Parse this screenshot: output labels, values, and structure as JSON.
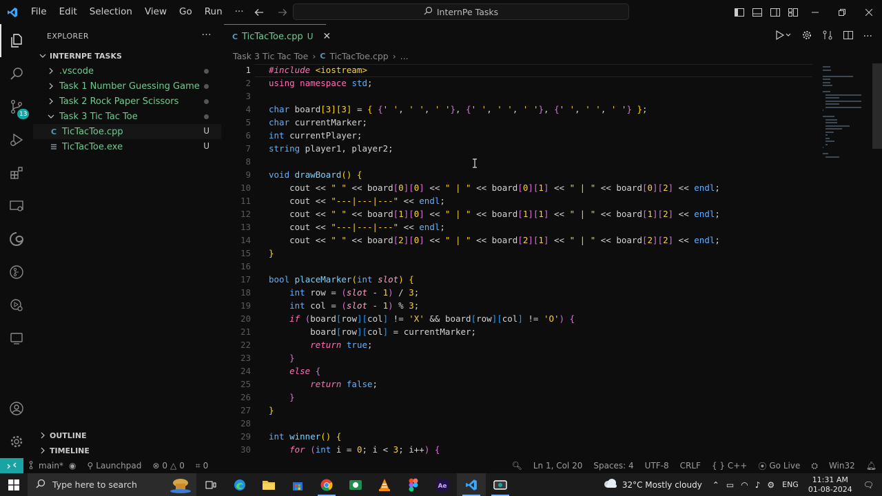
{
  "menu": [
    "File",
    "Edit",
    "Selection",
    "View",
    "Go",
    "Run",
    "···"
  ],
  "command_center": "InternPe Tasks",
  "activity": {
    "scm_badge": "13"
  },
  "sidebar": {
    "header": "EXPLORER",
    "workspace": "INTERNPE TASKS",
    "tree": [
      {
        "label": ".vscode",
        "depth": 1,
        "kind": "folder",
        "expanded": false,
        "color": "#73c991",
        "marker": "dot"
      },
      {
        "label": "Task 1 Number Guessing Game",
        "depth": 1,
        "kind": "folder",
        "expanded": false,
        "color": "#73c991",
        "marker": "dot"
      },
      {
        "label": "Task 2 Rock Paper Scissors",
        "depth": 1,
        "kind": "folder",
        "expanded": false,
        "color": "#73c991",
        "marker": "dot"
      },
      {
        "label": "Task 3 Tic Tac Toe",
        "depth": 1,
        "kind": "folder",
        "expanded": true,
        "color": "#73c991",
        "marker": "dot"
      },
      {
        "label": "TicTacToe.cpp",
        "depth": 2,
        "kind": "cpp",
        "color": "#73c991",
        "marker": "U"
      },
      {
        "label": "TicTacToe.exe",
        "depth": 2,
        "kind": "exe",
        "color": "#73c991",
        "marker": "U"
      }
    ],
    "outline": "OUTLINE",
    "timeline": "TIMELINE"
  },
  "tab": {
    "icon": "C",
    "name": "TicTacToe.cpp",
    "status": "U"
  },
  "breadcrumbs": {
    "folder": "Task 3 Tic Tac Toe",
    "icon": "C",
    "file": "TicTacToe.cpp",
    "more": "..."
  },
  "code_lines": [
    {
      "n": "1",
      "tokens": [
        [
          "k-pp",
          "#include"
        ],
        [
          "k-var",
          " "
        ],
        [
          "k-inc",
          "<iostream>"
        ]
      ]
    },
    {
      "n": "2",
      "tokens": [
        [
          "k-pink",
          "using"
        ],
        [
          "k-var",
          " "
        ],
        [
          "k-pink",
          "namespace"
        ],
        [
          "k-var",
          " "
        ],
        [
          "k-blue",
          "std"
        ],
        [
          "k-var",
          ";"
        ]
      ]
    },
    {
      "n": "3",
      "tokens": []
    },
    {
      "n": "4",
      "tokens": [
        [
          "k-blue",
          "char"
        ],
        [
          "k-var",
          " board"
        ],
        [
          "k-br1",
          "["
        ],
        [
          "k-num",
          "3"
        ],
        [
          "k-br1",
          "]["
        ],
        [
          "k-num",
          "3"
        ],
        [
          "k-br1",
          "]"
        ],
        [
          "k-var",
          " = "
        ],
        [
          "k-br1",
          "{ "
        ],
        [
          "k-br2",
          "{"
        ],
        [
          "k-str",
          "' '"
        ],
        [
          "k-var",
          ", "
        ],
        [
          "k-str",
          "' '"
        ],
        [
          "k-var",
          ", "
        ],
        [
          "k-str",
          "' '"
        ],
        [
          "k-br2",
          "}"
        ],
        [
          "k-var",
          ", "
        ],
        [
          "k-br2",
          "{"
        ],
        [
          "k-str",
          "' '"
        ],
        [
          "k-var",
          ", "
        ],
        [
          "k-str",
          "' '"
        ],
        [
          "k-var",
          ", "
        ],
        [
          "k-str",
          "' '"
        ],
        [
          "k-br2",
          "}"
        ],
        [
          "k-var",
          ", "
        ],
        [
          "k-br2",
          "{"
        ],
        [
          "k-str",
          "' '"
        ],
        [
          "k-var",
          ", "
        ],
        [
          "k-str",
          "' '"
        ],
        [
          "k-var",
          ", "
        ],
        [
          "k-str",
          "' '"
        ],
        [
          "k-br2",
          "}"
        ],
        [
          "k-br1",
          " }"
        ],
        [
          "k-var",
          ";"
        ]
      ]
    },
    {
      "n": "5",
      "tokens": [
        [
          "k-blue",
          "char"
        ],
        [
          "k-var",
          " currentMarker;"
        ]
      ]
    },
    {
      "n": "6",
      "tokens": [
        [
          "k-blue",
          "int"
        ],
        [
          "k-var",
          " currentPlayer;"
        ]
      ]
    },
    {
      "n": "7",
      "tokens": [
        [
          "k-blue",
          "string"
        ],
        [
          "k-var",
          " player1, player2;"
        ]
      ]
    },
    {
      "n": "8",
      "tokens": []
    },
    {
      "n": "9",
      "tokens": [
        [
          "k-blue",
          "void"
        ],
        [
          "k-var",
          " "
        ],
        [
          "k-fn",
          "drawBoard"
        ],
        [
          "k-br1",
          "()"
        ],
        [
          "k-var",
          " "
        ],
        [
          "k-br1",
          "{"
        ]
      ]
    },
    {
      "n": "10",
      "tokens": [
        [
          "k-var",
          "    cout << "
        ],
        [
          "k-str",
          "\" \""
        ],
        [
          "k-var",
          " << board"
        ],
        [
          "k-br2",
          "["
        ],
        [
          "k-num",
          "0"
        ],
        [
          "k-br2",
          "]["
        ],
        [
          "k-num",
          "0"
        ],
        [
          "k-br2",
          "]"
        ],
        [
          "k-var",
          " << "
        ],
        [
          "k-str",
          "\" | \""
        ],
        [
          "k-var",
          " << board"
        ],
        [
          "k-br2",
          "["
        ],
        [
          "k-num",
          "0"
        ],
        [
          "k-br2",
          "]["
        ],
        [
          "k-num",
          "1"
        ],
        [
          "k-br2",
          "]"
        ],
        [
          "k-var",
          " << "
        ],
        [
          "k-str",
          "\" | \""
        ],
        [
          "k-var",
          " << board"
        ],
        [
          "k-br2",
          "["
        ],
        [
          "k-num",
          "0"
        ],
        [
          "k-br2",
          "]["
        ],
        [
          "k-num",
          "2"
        ],
        [
          "k-br2",
          "]"
        ],
        [
          "k-var",
          " << "
        ],
        [
          "k-blue",
          "endl"
        ],
        [
          "k-var",
          ";"
        ]
      ]
    },
    {
      "n": "11",
      "tokens": [
        [
          "k-var",
          "    cout << "
        ],
        [
          "k-str",
          "\"---|---|---\""
        ],
        [
          "k-var",
          " << "
        ],
        [
          "k-blue",
          "endl"
        ],
        [
          "k-var",
          ";"
        ]
      ]
    },
    {
      "n": "12",
      "tokens": [
        [
          "k-var",
          "    cout << "
        ],
        [
          "k-str",
          "\" \""
        ],
        [
          "k-var",
          " << board"
        ],
        [
          "k-br2",
          "["
        ],
        [
          "k-num",
          "1"
        ],
        [
          "k-br2",
          "]["
        ],
        [
          "k-num",
          "0"
        ],
        [
          "k-br2",
          "]"
        ],
        [
          "k-var",
          " << "
        ],
        [
          "k-str",
          "\" | \""
        ],
        [
          "k-var",
          " << board"
        ],
        [
          "k-br2",
          "["
        ],
        [
          "k-num",
          "1"
        ],
        [
          "k-br2",
          "]["
        ],
        [
          "k-num",
          "1"
        ],
        [
          "k-br2",
          "]"
        ],
        [
          "k-var",
          " << "
        ],
        [
          "k-str",
          "\" | \""
        ],
        [
          "k-var",
          " << board"
        ],
        [
          "k-br2",
          "["
        ],
        [
          "k-num",
          "1"
        ],
        [
          "k-br2",
          "]["
        ],
        [
          "k-num",
          "2"
        ],
        [
          "k-br2",
          "]"
        ],
        [
          "k-var",
          " << "
        ],
        [
          "k-blue",
          "endl"
        ],
        [
          "k-var",
          ";"
        ]
      ]
    },
    {
      "n": "13",
      "tokens": [
        [
          "k-var",
          "    cout << "
        ],
        [
          "k-str",
          "\"---|---|---\""
        ],
        [
          "k-var",
          " << "
        ],
        [
          "k-blue",
          "endl"
        ],
        [
          "k-var",
          ";"
        ]
      ]
    },
    {
      "n": "14",
      "tokens": [
        [
          "k-var",
          "    cout << "
        ],
        [
          "k-str",
          "\" \""
        ],
        [
          "k-var",
          " << board"
        ],
        [
          "k-br2",
          "["
        ],
        [
          "k-num",
          "2"
        ],
        [
          "k-br2",
          "]["
        ],
        [
          "k-num",
          "0"
        ],
        [
          "k-br2",
          "]"
        ],
        [
          "k-var",
          " << "
        ],
        [
          "k-str",
          "\" | \""
        ],
        [
          "k-var",
          " << board"
        ],
        [
          "k-br2",
          "["
        ],
        [
          "k-num",
          "2"
        ],
        [
          "k-br2",
          "]["
        ],
        [
          "k-num",
          "1"
        ],
        [
          "k-br2",
          "]"
        ],
        [
          "k-var",
          " << "
        ],
        [
          "k-str",
          "\" | \""
        ],
        [
          "k-var",
          " << board"
        ],
        [
          "k-br2",
          "["
        ],
        [
          "k-num",
          "2"
        ],
        [
          "k-br2",
          "]["
        ],
        [
          "k-num",
          "2"
        ],
        [
          "k-br2",
          "]"
        ],
        [
          "k-var",
          " << "
        ],
        [
          "k-blue",
          "endl"
        ],
        [
          "k-var",
          ";"
        ]
      ]
    },
    {
      "n": "15",
      "tokens": [
        [
          "k-br1",
          "}"
        ]
      ]
    },
    {
      "n": "16",
      "tokens": []
    },
    {
      "n": "17",
      "tokens": [
        [
          "k-blue",
          "bool"
        ],
        [
          "k-var",
          " "
        ],
        [
          "k-fn",
          "placeMarker"
        ],
        [
          "k-br1",
          "("
        ],
        [
          "k-blue",
          "int"
        ],
        [
          "k-var",
          " "
        ],
        [
          "k-param",
          "slot"
        ],
        [
          "k-br1",
          ")"
        ],
        [
          "k-var",
          " "
        ],
        [
          "k-br1",
          "{"
        ]
      ]
    },
    {
      "n": "18",
      "tokens": [
        [
          "k-var",
          "    "
        ],
        [
          "k-blue",
          "int"
        ],
        [
          "k-var",
          " row = "
        ],
        [
          "k-br2",
          "("
        ],
        [
          "k-param",
          "slot"
        ],
        [
          "k-var",
          " - "
        ],
        [
          "k-num",
          "1"
        ],
        [
          "k-br2",
          ")"
        ],
        [
          "k-var",
          " / "
        ],
        [
          "k-num",
          "3"
        ],
        [
          "k-var",
          ";"
        ]
      ]
    },
    {
      "n": "19",
      "tokens": [
        [
          "k-var",
          "    "
        ],
        [
          "k-blue",
          "int"
        ],
        [
          "k-var",
          " col = "
        ],
        [
          "k-br2",
          "("
        ],
        [
          "k-param",
          "slot"
        ],
        [
          "k-var",
          " - "
        ],
        [
          "k-num",
          "1"
        ],
        [
          "k-br2",
          ")"
        ],
        [
          "k-var",
          " % "
        ],
        [
          "k-num",
          "3"
        ],
        [
          "k-var",
          ";"
        ]
      ]
    },
    {
      "n": "20",
      "tokens": [
        [
          "k-var",
          "    "
        ],
        [
          "k-ital",
          "if"
        ],
        [
          "k-var",
          " "
        ],
        [
          "k-br2",
          "("
        ],
        [
          "k-var",
          "board"
        ],
        [
          "k-br3",
          "["
        ],
        [
          "k-var",
          "row"
        ],
        [
          "k-br3",
          "]["
        ],
        [
          "k-var",
          "col"
        ],
        [
          "k-br3",
          "]"
        ],
        [
          "k-var",
          " != "
        ],
        [
          "k-str",
          "'X'"
        ],
        [
          "k-var",
          " && board"
        ],
        [
          "k-br3",
          "["
        ],
        [
          "k-var",
          "row"
        ],
        [
          "k-br3",
          "]["
        ],
        [
          "k-var",
          "col"
        ],
        [
          "k-br3",
          "]"
        ],
        [
          "k-var",
          " != "
        ],
        [
          "k-str",
          "'O'"
        ],
        [
          "k-br2",
          ")"
        ],
        [
          "k-var",
          " "
        ],
        [
          "k-br2",
          "{"
        ]
      ]
    },
    {
      "n": "21",
      "tokens": [
        [
          "k-var",
          "        board"
        ],
        [
          "k-br3",
          "["
        ],
        [
          "k-var",
          "row"
        ],
        [
          "k-br3",
          "]["
        ],
        [
          "k-var",
          "col"
        ],
        [
          "k-br3",
          "]"
        ],
        [
          "k-var",
          " = currentMarker;"
        ]
      ]
    },
    {
      "n": "22",
      "tokens": [
        [
          "k-var",
          "        "
        ],
        [
          "k-ital",
          "return"
        ],
        [
          "k-var",
          " "
        ],
        [
          "k-blue",
          "true"
        ],
        [
          "k-var",
          ";"
        ]
      ]
    },
    {
      "n": "23",
      "tokens": [
        [
          "k-var",
          "    "
        ],
        [
          "k-br2",
          "}"
        ]
      ]
    },
    {
      "n": "24",
      "tokens": [
        [
          "k-var",
          "    "
        ],
        [
          "k-ital",
          "else"
        ],
        [
          "k-var",
          " "
        ],
        [
          "k-br2",
          "{"
        ]
      ]
    },
    {
      "n": "25",
      "tokens": [
        [
          "k-var",
          "        "
        ],
        [
          "k-ital",
          "return"
        ],
        [
          "k-var",
          " "
        ],
        [
          "k-blue",
          "false"
        ],
        [
          "k-var",
          ";"
        ]
      ]
    },
    {
      "n": "26",
      "tokens": [
        [
          "k-var",
          "    "
        ],
        [
          "k-br2",
          "}"
        ]
      ]
    },
    {
      "n": "27",
      "tokens": [
        [
          "k-br1",
          "}"
        ]
      ]
    },
    {
      "n": "28",
      "tokens": []
    },
    {
      "n": "29",
      "tokens": [
        [
          "k-blue",
          "int"
        ],
        [
          "k-var",
          " "
        ],
        [
          "k-fn",
          "winner"
        ],
        [
          "k-br1",
          "()"
        ],
        [
          "k-var",
          " "
        ],
        [
          "k-br1",
          "{"
        ]
      ]
    },
    {
      "n": "30",
      "tokens": [
        [
          "k-var",
          "    "
        ],
        [
          "k-ital",
          "for"
        ],
        [
          "k-var",
          " "
        ],
        [
          "k-br2",
          "("
        ],
        [
          "k-blue",
          "int"
        ],
        [
          "k-var",
          " i = "
        ],
        [
          "k-num",
          "0"
        ],
        [
          "k-var",
          "; i < "
        ],
        [
          "k-num",
          "3"
        ],
        [
          "k-var",
          "; i++"
        ],
        [
          "k-br2",
          ")"
        ],
        [
          "k-var",
          " "
        ],
        [
          "k-br2",
          "{"
        ]
      ]
    }
  ],
  "status": {
    "branch": "main*",
    "launchpad": "Launchpad",
    "errors": "0",
    "warnings": "0",
    "ports": "0",
    "position": "Ln 1, Col 20",
    "spaces": "Spaces: 4",
    "encoding": "UTF-8",
    "eol": "CRLF",
    "language": "{ } C++",
    "golive": "Go Live",
    "platform": "Win32"
  },
  "taskbar": {
    "search_placeholder": "Type here to search",
    "weather": "32°C  Mostly cloudy",
    "lang": "ENG",
    "time": "11:31 AM",
    "date": "01-08-2024"
  },
  "colors": {
    "accent": "#1aa3a3",
    "untracked": "#73c991"
  }
}
